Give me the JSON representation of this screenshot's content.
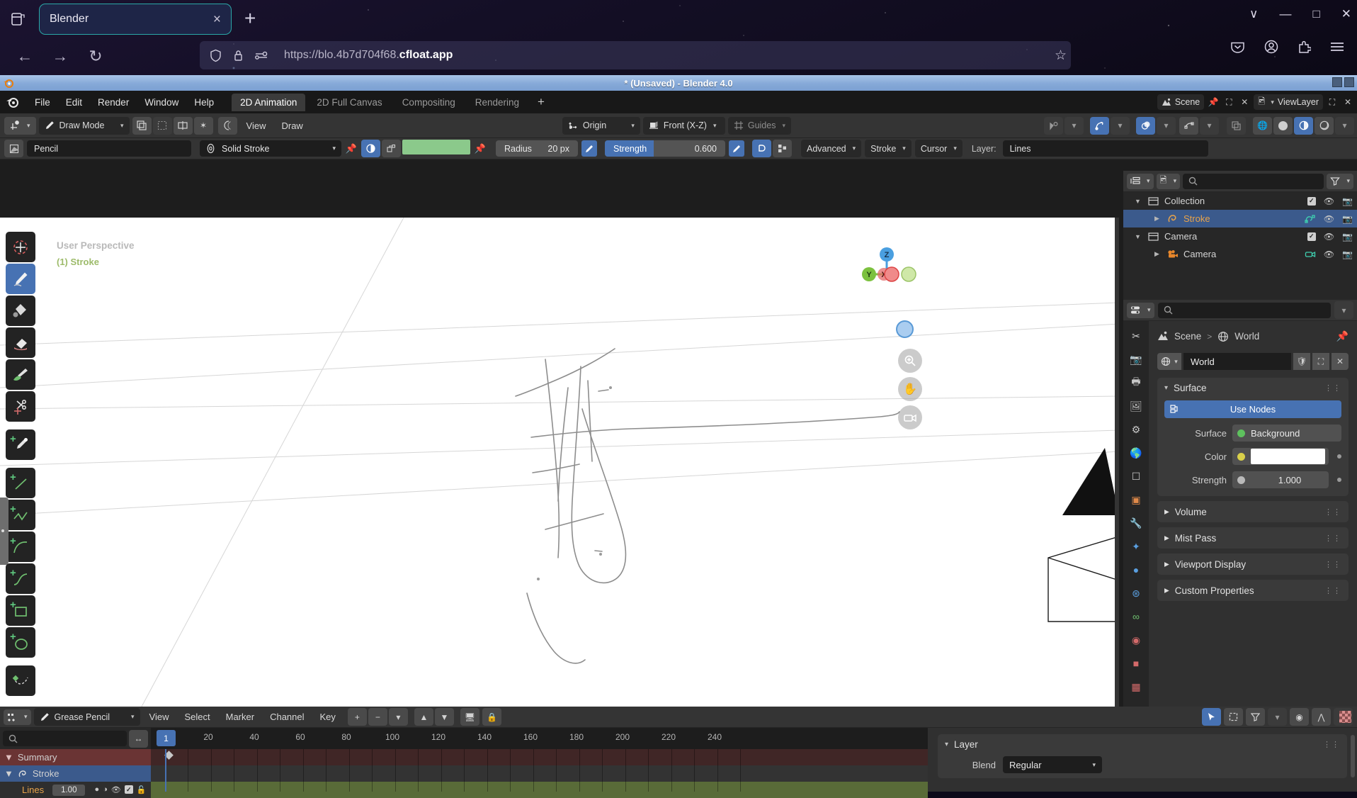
{
  "browser": {
    "tab": {
      "title": "Blender",
      "close_label": "×"
    },
    "new_tab_label": "+",
    "nav": {
      "back": "←",
      "forward": "→",
      "reload": "↻"
    },
    "url": {
      "prefix": "https://blo.4b7d704f68.",
      "domain": "cfloat.app"
    },
    "window_controls": {
      "chevron": "∨",
      "minimize": "—",
      "maximize": "□",
      "close": "✕"
    }
  },
  "blender": {
    "title": "* (Unsaved) - Blender 4.0",
    "menus": [
      "File",
      "Edit",
      "Render",
      "Window",
      "Help"
    ],
    "workspace_tabs": [
      {
        "label": "2D Animation",
        "active": true
      },
      {
        "label": "2D Full Canvas",
        "active": false
      },
      {
        "label": "Compositing",
        "active": false
      },
      {
        "label": "Rendering",
        "active": false
      }
    ],
    "workspace_add": "+",
    "scene_name": "Scene",
    "view_layer_name": "ViewLayer"
  },
  "tool_header": {
    "mode": "Draw Mode",
    "menus": [
      "View",
      "Draw"
    ],
    "pivot": "Origin",
    "orientation": "Front (X-Z)",
    "guides": "Guides",
    "chevron": "∨"
  },
  "tool_settings": {
    "brush_name": "Pencil",
    "material_name": "Solid Stroke",
    "material_color": "#8bc98b",
    "radius_label": "Radius",
    "radius_value": "20 px",
    "strength_label": "Strength",
    "strength_value": "0.600",
    "advanced": "Advanced",
    "stroke": "Stroke",
    "cursor": "Cursor",
    "layer_label": "Layer:",
    "layer_value": "Lines"
  },
  "viewport": {
    "perspective_text": "User Perspective",
    "object_text": "(1) Stroke",
    "gizmo_axes": [
      "X",
      "Y",
      "Z"
    ],
    "nav_buttons": [
      "zoom-in",
      "pan-hand",
      "camera-view"
    ],
    "tools": [
      "tweak-tool",
      "draw-tool",
      "fill-tool",
      "erase-tool",
      "tint-tool",
      "cutter-tool",
      "eyedropper-tool",
      "line-tool",
      "polyline-tool",
      "arc-tool",
      "curve-tool",
      "box-tool",
      "circle-tool",
      "interpolate-tool"
    ]
  },
  "outliner": {
    "view_layer": "ViewLayer",
    "search_placeholder": "",
    "rows": [
      {
        "name": "Collection",
        "type": "collection",
        "expanded": true,
        "indent": 0,
        "checkbox": true,
        "selected": false
      },
      {
        "name": "Stroke",
        "type": "gpencil",
        "expanded": false,
        "indent": 1,
        "checkbox": false,
        "selected": true
      },
      {
        "name": "Camera",
        "type": "collection",
        "expanded": true,
        "indent": 0,
        "checkbox": true,
        "selected": false
      },
      {
        "name": "Camera",
        "type": "camera",
        "expanded": false,
        "indent": 1,
        "checkbox": false,
        "selected": false
      }
    ]
  },
  "properties": {
    "breadcrumb": {
      "scene": "Scene",
      "separator": ">",
      "world": "World"
    },
    "id_name": "World",
    "panels": {
      "surface": {
        "title": "Surface",
        "use_nodes": "Use Nodes",
        "surface_label": "Surface",
        "surface_value": "Background",
        "color_label": "Color",
        "color_value": "#ffffff",
        "strength_label": "Strength",
        "strength_value": "1.000"
      },
      "closed": [
        "Volume",
        "Mist Pass",
        "Viewport Display",
        "Custom Properties"
      ]
    }
  },
  "dopesheet": {
    "editor_mode": "Grease Pencil",
    "menus": [
      "View",
      "Select",
      "Marker",
      "Channel",
      "Key"
    ],
    "search_placeholder": "",
    "current_frame": "1",
    "ruler_ticks": [
      "20",
      "40",
      "60",
      "80",
      "100",
      "120",
      "140",
      "160",
      "180",
      "200",
      "220",
      "240"
    ],
    "channels": [
      {
        "label": "Summary",
        "kind": "summary"
      },
      {
        "label": "Stroke",
        "kind": "object"
      },
      {
        "label": "Lines",
        "kind": "layer",
        "opacity": "1.00"
      }
    ]
  },
  "layer_panel": {
    "title": "Layer",
    "blend_label": "Blend",
    "blend_value": "Regular"
  }
}
